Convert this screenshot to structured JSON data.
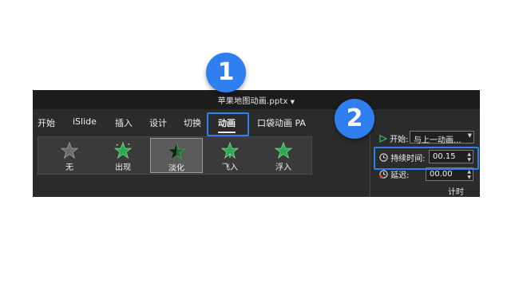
{
  "window": {
    "title": "苹果地图动画.pptx"
  },
  "tabs": [
    {
      "label": "开始",
      "active": false
    },
    {
      "label": "iSlide",
      "active": false
    },
    {
      "label": "插入",
      "active": false
    },
    {
      "label": "设计",
      "active": false
    },
    {
      "label": "切换",
      "active": false
    },
    {
      "label": "动画",
      "active": true
    },
    {
      "label": "口袋动画 PA",
      "active": false
    }
  ],
  "animations": [
    {
      "label": "无",
      "icon": "star-gray-icon",
      "selected": false
    },
    {
      "label": "出现",
      "icon": "star-green-icon",
      "selected": false
    },
    {
      "label": "淡化",
      "icon": "star-half-icon",
      "selected": true
    },
    {
      "label": "飞入",
      "icon": "star-fly-icon",
      "selected": false
    },
    {
      "label": "浮入",
      "icon": "star-green-icon",
      "selected": false
    }
  ],
  "timing": {
    "start_label": "开始:",
    "start_value": "与上一动画...",
    "duration_label": "持续时间:",
    "duration_value": "00.15",
    "delay_label": "延迟:",
    "delay_value": "00.00",
    "group_label": "计时"
  },
  "badges": {
    "one": "1",
    "two": "2"
  },
  "colors": {
    "accent": "#2f7ff0",
    "star_green": "#2fa84f",
    "ribbon_bg": "#2b2b2b"
  }
}
